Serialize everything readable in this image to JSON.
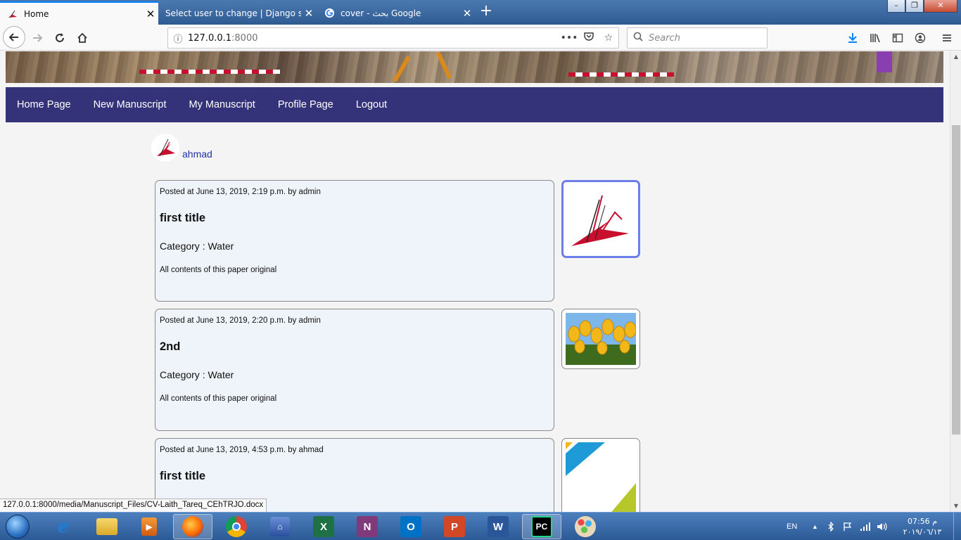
{
  "browser": {
    "tabs": [
      {
        "title": "Home",
        "active": true
      },
      {
        "title": "Select user to change | Django site a",
        "active": false
      },
      {
        "title": "cover - بحث Google",
        "active": false
      }
    ],
    "url_host": "127.0.0.1",
    "url_port": ":8000",
    "search_placeholder": "Search",
    "window_controls": {
      "minimize": "–",
      "maximize": "❐",
      "close": "✕"
    }
  },
  "site": {
    "nav": [
      "Home Page",
      "New Manuscript",
      "My Manuscript",
      "Profile Page",
      "Logout"
    ],
    "author": "ahmad",
    "posts": [
      {
        "meta": "Posted at June 13, 2019, 2:19 p.m. by admin",
        "title": "first title",
        "category": "Category : Water",
        "desc": "All contents of this paper original",
        "thumb": "bird-logo"
      },
      {
        "meta": "Posted at June 13, 2019, 2:20 p.m. by admin",
        "title": "2nd",
        "category": "Category : Water",
        "desc": "All contents of this paper original",
        "thumb": "tulips-photo"
      },
      {
        "meta": "Posted at June 13, 2019, 4:53 p.m. by ahmad",
        "title": "first title",
        "category": "",
        "desc": "",
        "thumb": "document-cover"
      }
    ]
  },
  "statusbar": "127.0.0.1:8000/media/Manuscript_Files/CV-Laith_Tareq_CEhTRJO.docx",
  "taskbar": {
    "language": "EN",
    "time": "07:56 م",
    "date": "٢٠١٩/٠٦/١٣",
    "apps": [
      "internet-explorer",
      "file-explorer",
      "media-player",
      "firefox",
      "chrome",
      "network-app",
      "excel",
      "onenote",
      "outlook",
      "powerpoint",
      "word",
      "pycharm",
      "paint"
    ]
  },
  "colors": {
    "nav_bg": "#343279",
    "link": "#2431a6",
    "card_bg": "#eef4fa",
    "selected_border": "#6d7ee8"
  }
}
